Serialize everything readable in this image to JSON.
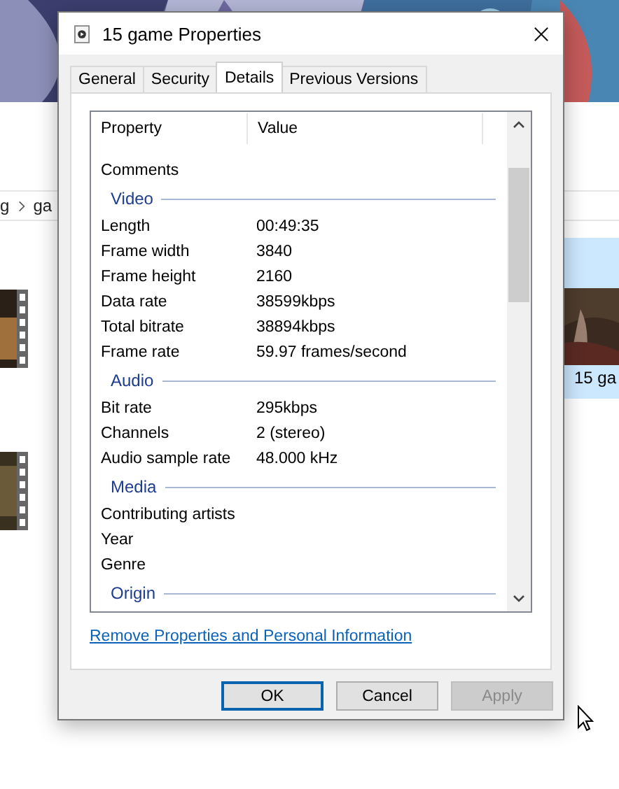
{
  "background": {
    "breadcrumb": [
      "g",
      "ga"
    ],
    "selected_item": {
      "label": "15 ga",
      "selected": true
    }
  },
  "window": {
    "title": "15 game Properties"
  },
  "tabs": [
    {
      "label": "General",
      "selected": false
    },
    {
      "label": "Security",
      "selected": false
    },
    {
      "label": "Details",
      "selected": true
    },
    {
      "label": "Previous Versions",
      "selected": false
    }
  ],
  "columns": [
    "Property",
    "Value"
  ],
  "rows": [
    {
      "kind": "row",
      "property": "Comments"
    },
    {
      "kind": "group",
      "property": "Video"
    },
    {
      "kind": "row",
      "property": "Length",
      "value": "00:49:35"
    },
    {
      "kind": "row",
      "property": "Frame width",
      "value": "3840"
    },
    {
      "kind": "row",
      "property": "Frame height",
      "value": "2160"
    },
    {
      "kind": "row",
      "property": "Data rate",
      "value": "38599kbps"
    },
    {
      "kind": "row",
      "property": "Total bitrate",
      "value": "38894kbps"
    },
    {
      "kind": "row",
      "property": "Frame rate",
      "value": "59.97 frames/second"
    },
    {
      "kind": "group",
      "property": "Audio"
    },
    {
      "kind": "row",
      "property": "Bit rate",
      "value": "295kbps"
    },
    {
      "kind": "row",
      "property": "Channels",
      "value": "2 (stereo)"
    },
    {
      "kind": "row",
      "property": "Audio sample rate",
      "value": "48.000 kHz"
    },
    {
      "kind": "group",
      "property": "Media"
    },
    {
      "kind": "row",
      "property": "Contributing artists"
    },
    {
      "kind": "row",
      "property": "Year"
    },
    {
      "kind": "row",
      "property": "Genre"
    },
    {
      "kind": "group",
      "property": "Origin"
    }
  ],
  "link": "Remove Properties and Personal Information",
  "buttons": [
    {
      "label": "OK",
      "default": true,
      "disabled": false
    },
    {
      "label": "Cancel",
      "default": false,
      "disabled": false
    },
    {
      "label": "Apply",
      "default": false,
      "disabled": true
    }
  ]
}
